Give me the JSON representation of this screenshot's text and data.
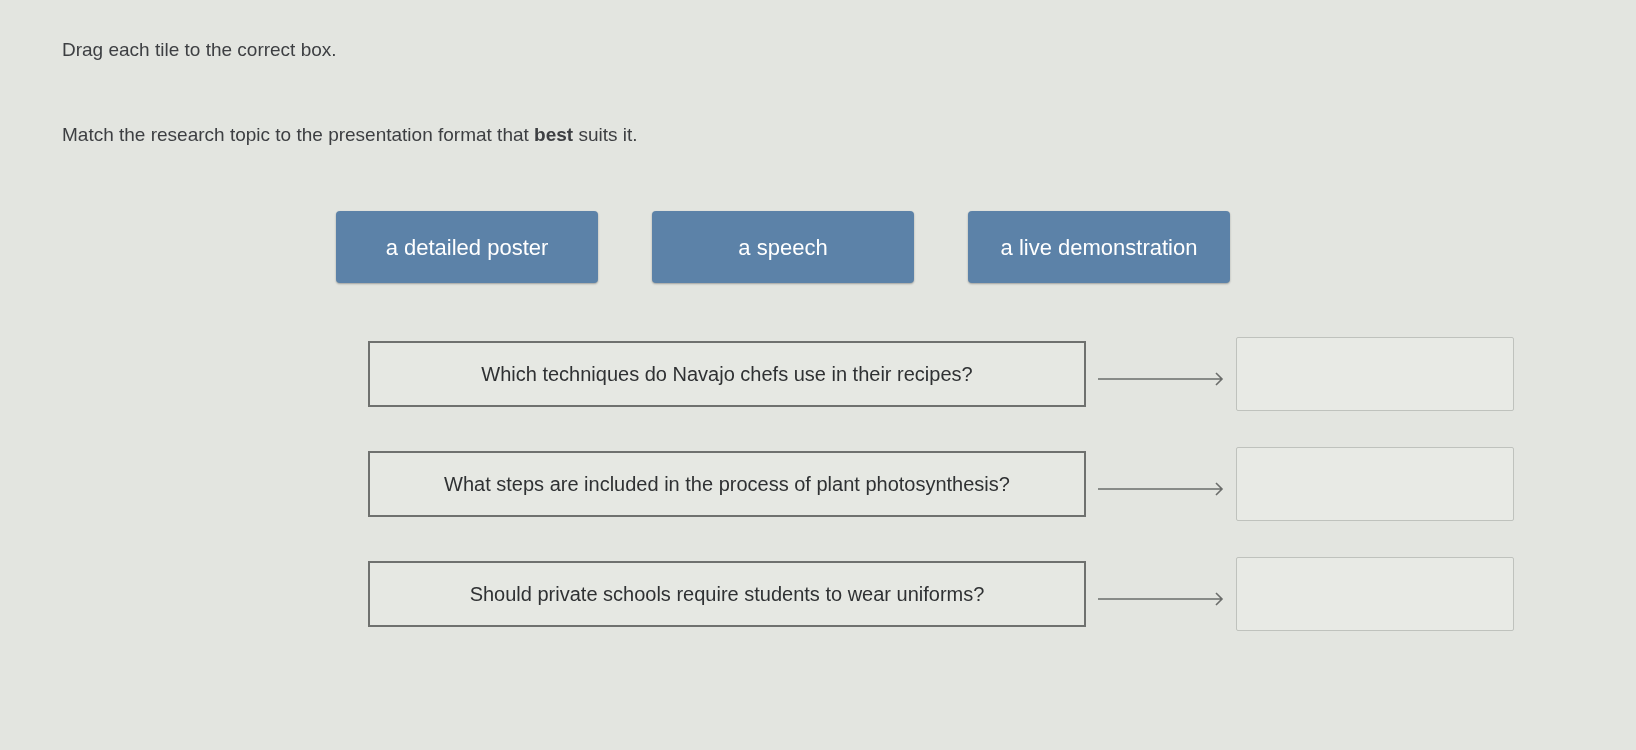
{
  "instructions": "Drag each tile to the correct box.",
  "prompt": "Match the research topic to the presentation format that **best** suits it.",
  "tiles": [
    {
      "label": "a detailed poster"
    },
    {
      "label": "a speech"
    },
    {
      "label": "a live demonstration"
    }
  ],
  "rows": [
    {
      "question": "Which techniques do Navajo chefs use in their recipes?"
    },
    {
      "question": "What steps are included in the process of plant photosynthesis?"
    },
    {
      "question": "Should private schools require students to wear uniforms?"
    }
  ]
}
